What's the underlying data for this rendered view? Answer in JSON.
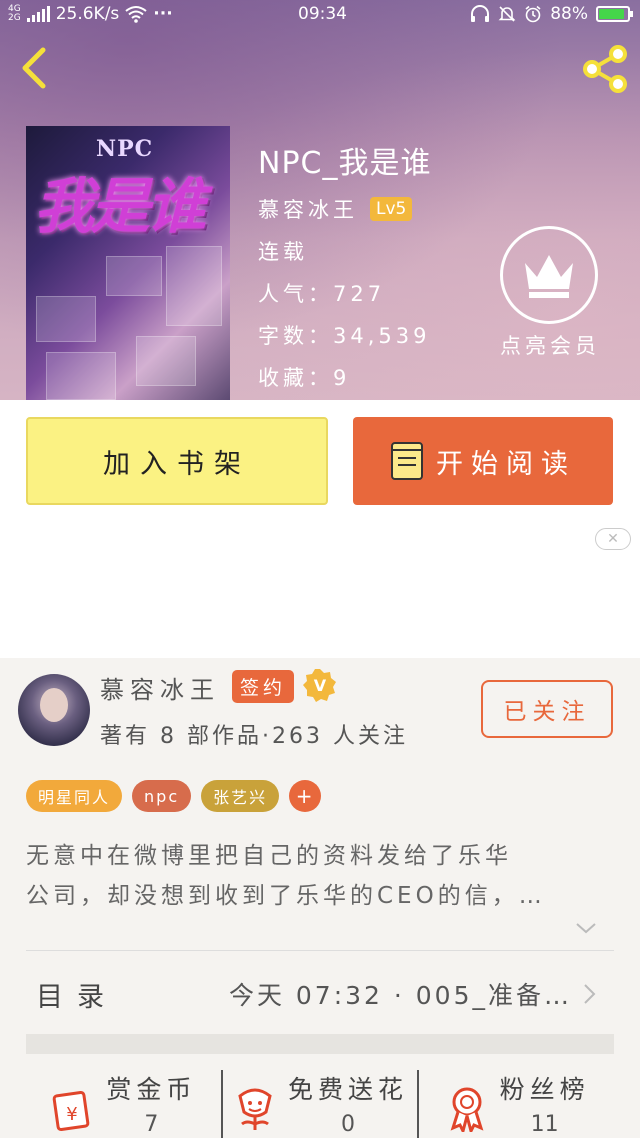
{
  "status_bar": {
    "network_top": "4G",
    "network_bottom": "2G",
    "speed": "25.6K/s",
    "more": "···",
    "time": "09:34",
    "battery": "88%",
    "battery_level": 0.88
  },
  "book": {
    "cover_label": "NPC",
    "cover_title": "我是谁",
    "title": "NPC_我是谁",
    "author": "慕容冰王",
    "level": "Lv5",
    "status": "连载",
    "popularity": "人气：727",
    "word_count": "字数：34,539",
    "favorites": "收藏：9"
  },
  "vip": {
    "label": "点亮会员"
  },
  "actions": {
    "add_shelf": "加入书架",
    "start_read": "开始阅读"
  },
  "author_card": {
    "name": "慕容冰王",
    "signed_badge": "签约",
    "v_badge": "V",
    "stats": "著有 8 部作品·263 人关注",
    "follow_label": "已关注"
  },
  "tags": [
    {
      "label": "明星同人",
      "color": "#f2a93b"
    },
    {
      "label": "npc",
      "color": "#d76c4c"
    },
    {
      "label": "张艺兴",
      "color": "#c9a23a"
    },
    {
      "label": "+",
      "color": "#e8683c"
    }
  ],
  "description": {
    "line1": "无意中在微博里把自己的资料发给了乐华",
    "line2": "公司，却没想到收到了乐华的CEO的信，…"
  },
  "toc": {
    "label": "目录",
    "latest": "今天 07:32 · 005_准备…"
  },
  "stats": [
    {
      "label": "赏金币",
      "value": "7",
      "icon": "reward-coin-icon"
    },
    {
      "label": "免费送花",
      "value": "0",
      "icon": "flower-icon"
    },
    {
      "label": "粉丝榜",
      "value": "11",
      "icon": "medal-icon"
    }
  ],
  "colors": {
    "accent": "#e8683c",
    "shelf_button": "#fbf283",
    "level_badge": "#f3b83c"
  }
}
